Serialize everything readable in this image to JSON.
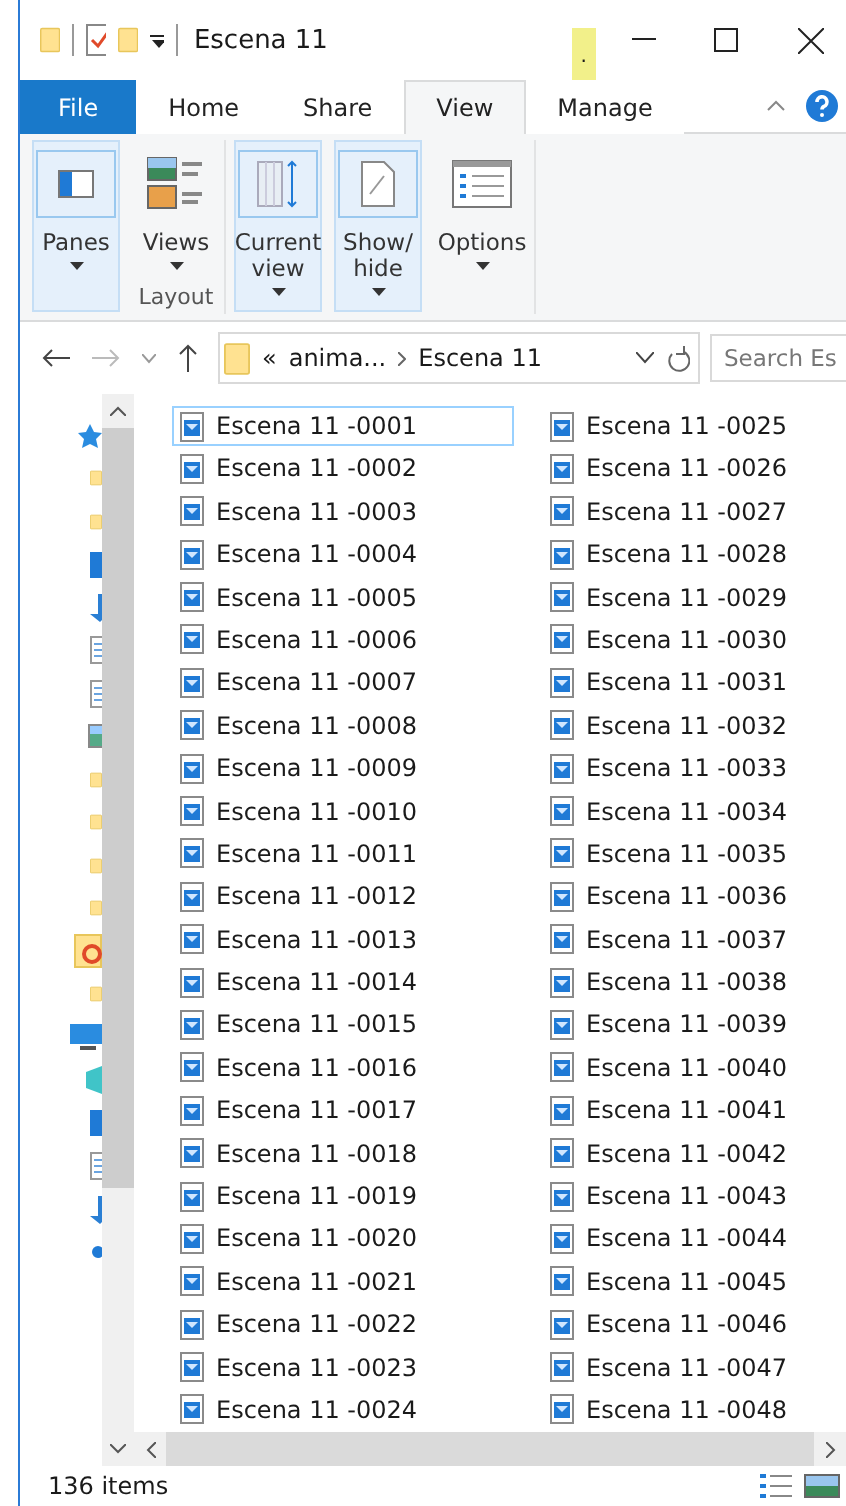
{
  "title_bar": {
    "title": "Escena 11",
    "context_marker": "."
  },
  "tabs": [
    {
      "label": "File",
      "kind": "file",
      "selected": false
    },
    {
      "label": "Home",
      "kind": "tab",
      "selected": false
    },
    {
      "label": "Share",
      "kind": "tab",
      "selected": false
    },
    {
      "label": "View",
      "kind": "tab",
      "selected": true
    },
    {
      "label": "Manage",
      "kind": "tab",
      "selected": false
    }
  ],
  "ribbon": {
    "groups": [
      {
        "buttons": [
          {
            "label": "Panes",
            "kind": "panes",
            "dropdown": true,
            "highlighted": true
          }
        ]
      },
      {
        "label": "Layout",
        "buttons": [
          {
            "label": "Views",
            "kind": "views",
            "dropdown": true,
            "highlighted": false
          }
        ]
      },
      {
        "buttons": [
          {
            "label": "Current view",
            "kind": "current",
            "dropdown": true,
            "highlighted": true
          }
        ]
      },
      {
        "buttons": [
          {
            "label": "Show/ hide",
            "kind": "showhide",
            "dropdown": true,
            "highlighted": true
          }
        ]
      },
      {
        "buttons": [
          {
            "label": "Options",
            "kind": "options",
            "dropdown": true,
            "highlighted": false
          }
        ]
      }
    ]
  },
  "address_bar": {
    "overflow": "«",
    "path": [
      "anima...",
      "Escena 11"
    ],
    "search_placeholder": "Search Es"
  },
  "files": [
    {
      "name": "Escena 11 -0001",
      "selected": true
    },
    {
      "name": "Escena 11 -0002",
      "selected": false
    },
    {
      "name": "Escena 11 -0003",
      "selected": false
    },
    {
      "name": "Escena 11 -0004",
      "selected": false
    },
    {
      "name": "Escena 11 -0005",
      "selected": false
    },
    {
      "name": "Escena 11 -0006",
      "selected": false
    },
    {
      "name": "Escena 11 -0007",
      "selected": false
    },
    {
      "name": "Escena 11 -0008",
      "selected": false
    },
    {
      "name": "Escena 11 -0009",
      "selected": false
    },
    {
      "name": "Escena 11 -0010",
      "selected": false
    },
    {
      "name": "Escena 11 -0011",
      "selected": false
    },
    {
      "name": "Escena 11 -0012",
      "selected": false
    },
    {
      "name": "Escena 11 -0013",
      "selected": false
    },
    {
      "name": "Escena 11 -0014",
      "selected": false
    },
    {
      "name": "Escena 11 -0015",
      "selected": false
    },
    {
      "name": "Escena 11 -0016",
      "selected": false
    },
    {
      "name": "Escena 11 -0017",
      "selected": false
    },
    {
      "name": "Escena 11 -0018",
      "selected": false
    },
    {
      "name": "Escena 11 -0019",
      "selected": false
    },
    {
      "name": "Escena 11 -0020",
      "selected": false
    },
    {
      "name": "Escena 11 -0021",
      "selected": false
    },
    {
      "name": "Escena 11 -0022",
      "selected": false
    },
    {
      "name": "Escena 11 -0023",
      "selected": false
    },
    {
      "name": "Escena 11 -0024",
      "selected": false
    },
    {
      "name": "Escena 11 -0025",
      "selected": false
    },
    {
      "name": "Escena 11 -0026",
      "selected": false
    },
    {
      "name": "Escena 11 -0027",
      "selected": false
    },
    {
      "name": "Escena 11 -0028",
      "selected": false
    },
    {
      "name": "Escena 11 -0029",
      "selected": false
    },
    {
      "name": "Escena 11 -0030",
      "selected": false
    },
    {
      "name": "Escena 11 -0031",
      "selected": false
    },
    {
      "name": "Escena 11 -0032",
      "selected": false
    },
    {
      "name": "Escena 11 -0033",
      "selected": false
    },
    {
      "name": "Escena 11 -0034",
      "selected": false
    },
    {
      "name": "Escena 11 -0035",
      "selected": false
    },
    {
      "name": "Escena 11 -0036",
      "selected": false
    },
    {
      "name": "Escena 11 -0037",
      "selected": false
    },
    {
      "name": "Escena 11 -0038",
      "selected": false
    },
    {
      "name": "Escena 11 -0039",
      "selected": false
    },
    {
      "name": "Escena 11 -0040",
      "selected": false
    },
    {
      "name": "Escena 11 -0041",
      "selected": false
    },
    {
      "name": "Escena 11 -0042",
      "selected": false
    },
    {
      "name": "Escena 11 -0043",
      "selected": false
    },
    {
      "name": "Escena 11 -0044",
      "selected": false
    },
    {
      "name": "Escena 11 -0045",
      "selected": false
    },
    {
      "name": "Escena 11 -0046",
      "selected": false
    },
    {
      "name": "Escena 11 -0047",
      "selected": false
    },
    {
      "name": "Escena 11 -0048",
      "selected": false
    }
  ],
  "status_bar": {
    "item_count": "136 items"
  }
}
